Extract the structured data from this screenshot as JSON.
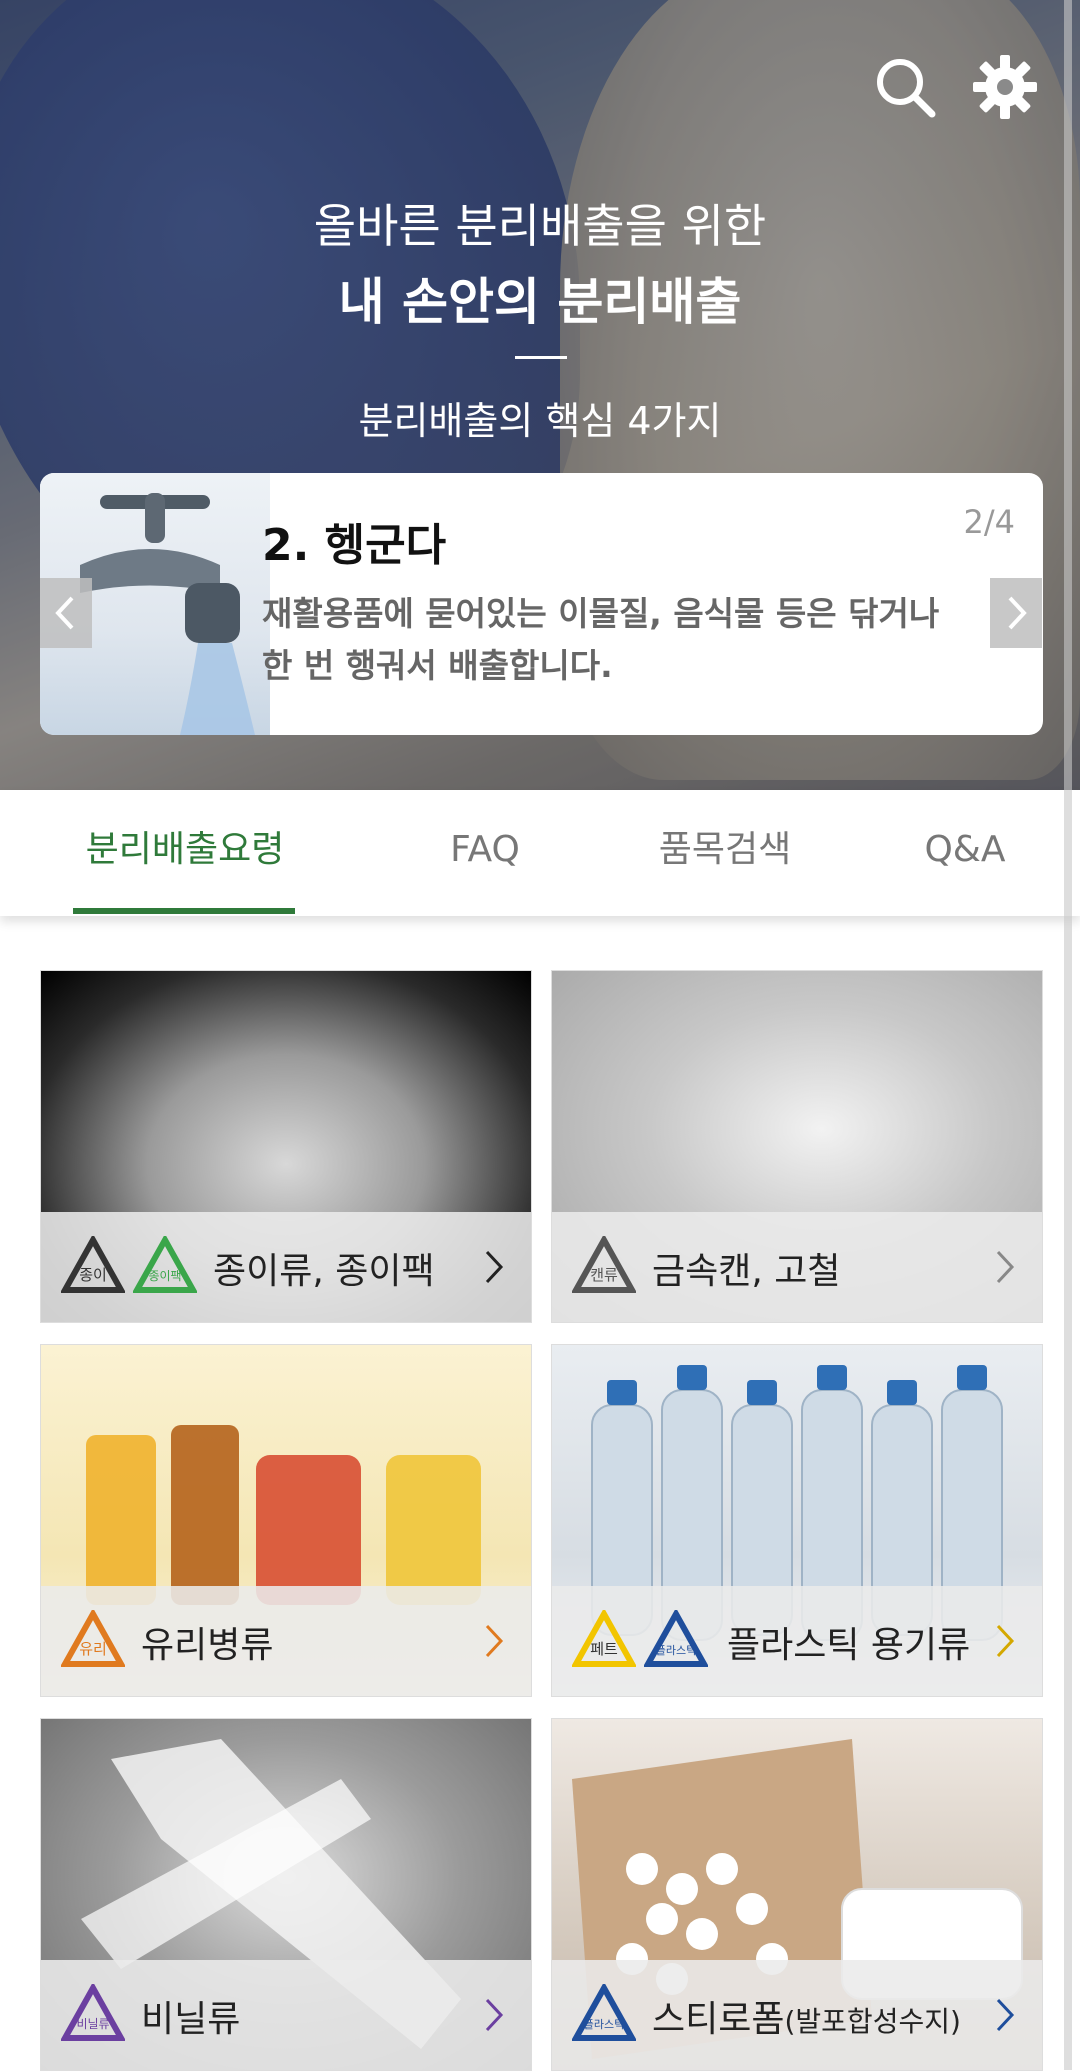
{
  "hero": {
    "subtitle": "올바른 분리배출을 위한",
    "title": "내 손안의 분리배출",
    "caption": "분리배출의 핵심 4가지"
  },
  "slide": {
    "title": "2. 헹군다",
    "counter": "2/4",
    "desc_line1": "재활용품에 묻어있는 이물질, 음식물 등은 닦거나",
    "desc_line2": "한 번 행궈서 배출합니다."
  },
  "tabs": [
    {
      "label": "분리배출요령"
    },
    {
      "label": "FAQ"
    },
    {
      "label": "품목검색"
    },
    {
      "label": "Q&A"
    }
  ],
  "categories": [
    {
      "label": "종이류, 종이팩",
      "badges": [
        "종이",
        "종이팩"
      ]
    },
    {
      "label": "금속캔, 고철",
      "badges": [
        "캔류"
      ]
    },
    {
      "label": "유리병류",
      "badges": [
        "유리"
      ]
    },
    {
      "label": "플라스틱 용기류",
      "badges": [
        "페트",
        "플라스틱"
      ]
    },
    {
      "label": "비닐류",
      "badges": [
        "비닐류"
      ]
    },
    {
      "label": "스티로폼",
      "label_small": "(발포합성수지)",
      "badges": [
        "플라스틱"
      ]
    }
  ],
  "colors": {
    "accent": "#2f7a3a",
    "badge_orange": "#e07a1f",
    "badge_yellow": "#f2c500",
    "badge_blue": "#1f4e9c",
    "badge_purple": "#6b3fa0",
    "badge_green": "#3aa64a"
  }
}
